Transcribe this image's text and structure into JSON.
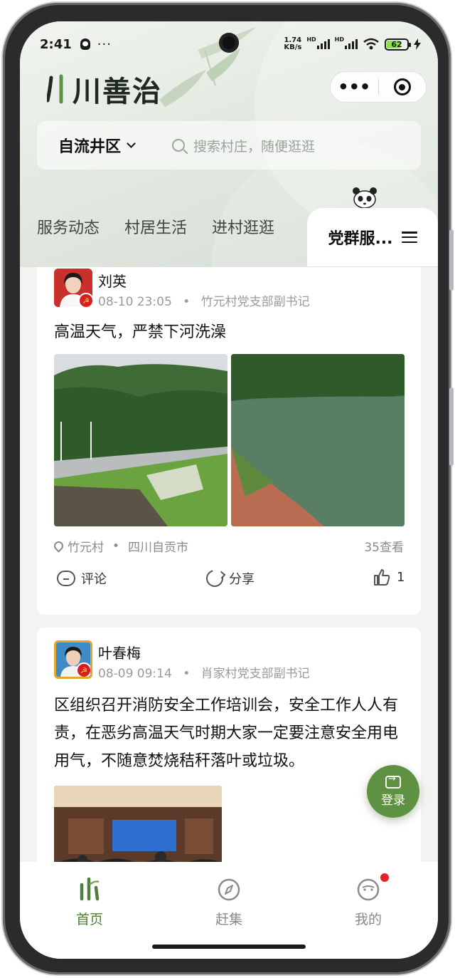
{
  "status_bar": {
    "time": "2:41",
    "dots": "···",
    "speed_top": "1.74",
    "speed_bottom": "KB/s",
    "hd1": "HD",
    "hd2": "HD",
    "battery": "62"
  },
  "header": {
    "app_name": "川善治",
    "capsule_more": "•••"
  },
  "search": {
    "district": "自流井区",
    "placeholder": "搜索村庄，随便逛逛"
  },
  "tabs": {
    "items": [
      "服务动态",
      "村居生活",
      "进村逛逛"
    ],
    "active": "党群服..."
  },
  "posts": [
    {
      "author": "刘英",
      "time": "08-10 23:05",
      "dot": "•",
      "role": "竹元村党支部副书记",
      "text": "高温天气，严禁下河洗澡",
      "location_village": "竹元村",
      "location_city": "四川自贡市",
      "views": "35查看",
      "comment_label": "评论",
      "share_label": "分享",
      "likes": "1"
    },
    {
      "author": "叶春梅",
      "time": "08-09 09:14",
      "dot": "•",
      "role": "肖家村党支部副书记",
      "text": "区组织召开消防安全工作培训会，安全工作人人有责，在恶劣高温天气时期大家一定要注意安全用电用气，不随意焚烧秸秆落叶或垃圾。"
    }
  ],
  "fab": {
    "label": "登录"
  },
  "tabbar": {
    "items": [
      "首页",
      "赶集",
      "我的"
    ],
    "active": "首页"
  },
  "colors": {
    "accent": "#5f9142",
    "active_tab": "#4f7d3a",
    "badge_red": "#e8212d"
  }
}
